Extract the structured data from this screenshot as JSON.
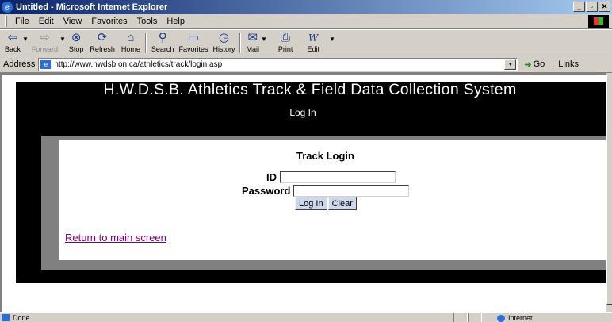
{
  "window": {
    "title": "Untitled - Microsoft Internet Explorer",
    "controls": [
      "_",
      "▫",
      "✕"
    ]
  },
  "menubar": {
    "items": [
      {
        "accel": "F",
        "rest": "ile"
      },
      {
        "accel": "E",
        "rest": "dit"
      },
      {
        "accel": "V",
        "rest": "iew"
      },
      {
        "pre": "F",
        "accel": "a",
        "rest": "vorites"
      },
      {
        "accel": "T",
        "rest": "ools"
      },
      {
        "accel": "H",
        "rest": "elp"
      }
    ]
  },
  "toolbar": {
    "back": "Back",
    "forward": "Forward",
    "stop": "Stop",
    "refresh": "Refresh",
    "home": "Home",
    "search": "Search",
    "favorites": "Favorites",
    "history": "History",
    "mail": "Mail",
    "print": "Print",
    "edit": "Edit"
  },
  "addressbar": {
    "label": "Address",
    "url": "http://www.hwdsb.on.ca/athletics/track/login.asp",
    "go": "Go",
    "links": "Links"
  },
  "page": {
    "site_title": "H.W.D.S.B. Athletics Track & Field Data Collection System",
    "nav_login": "Log In",
    "form_title": "Track Login",
    "id_label": "ID",
    "id_value": "",
    "password_label": "Password",
    "password_value": "",
    "login_button": "Log In",
    "clear_button": "Clear",
    "return_link": "Return to main screen"
  },
  "statusbar": {
    "status": "Done",
    "zone": "Internet"
  },
  "colors": {
    "title_gradient_start": "#0a246a",
    "chrome": "#d4d0c8",
    "band": "#000000",
    "frame": "#808080",
    "link_visited": "#800080"
  }
}
